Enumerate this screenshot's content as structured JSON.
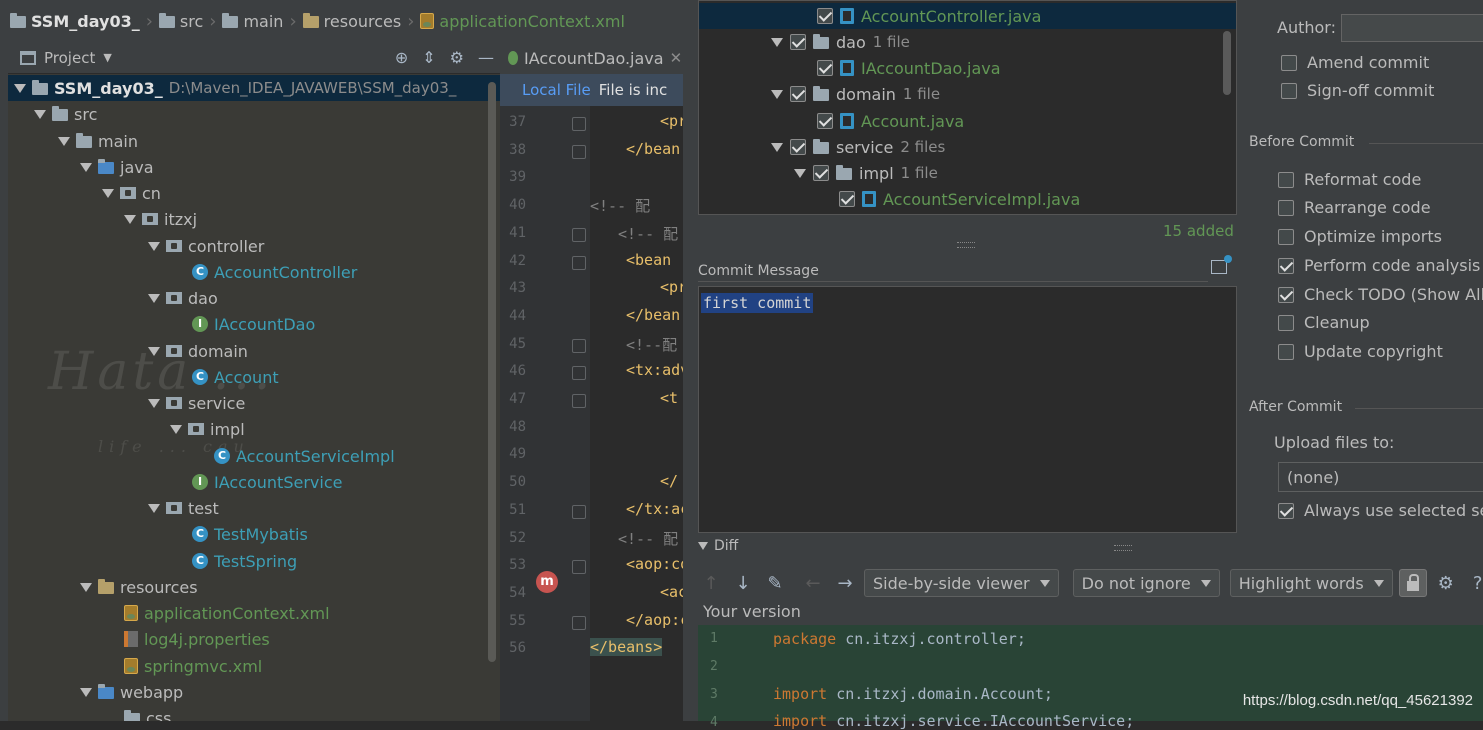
{
  "breadcrumb": {
    "items": [
      {
        "label": "SSM_day03_",
        "icon": "project-folder-icon"
      },
      {
        "label": "src",
        "icon": "folder-icon"
      },
      {
        "label": "main",
        "icon": "folder-icon"
      },
      {
        "label": "resources",
        "icon": "resources-folder-icon"
      },
      {
        "label": "applicationContext.xml",
        "icon": "xml-file-icon"
      }
    ]
  },
  "project_panel": {
    "title": "Project",
    "root": {
      "label": "SSM_day03_",
      "path": "D:\\Maven_IDEA_JAVAWEB\\SSM_day03_"
    },
    "tree": [
      {
        "label": "src",
        "kind": "folder"
      },
      {
        "label": "main",
        "kind": "folder"
      },
      {
        "label": "java",
        "kind": "source-folder"
      },
      {
        "label": "cn",
        "kind": "package"
      },
      {
        "label": "itzxj",
        "kind": "package"
      },
      {
        "label": "controller",
        "kind": "package"
      },
      {
        "label": "AccountController",
        "kind": "class"
      },
      {
        "label": "dao",
        "kind": "package"
      },
      {
        "label": "IAccountDao",
        "kind": "interface"
      },
      {
        "label": "domain",
        "kind": "package"
      },
      {
        "label": "Account",
        "kind": "class"
      },
      {
        "label": "service",
        "kind": "package"
      },
      {
        "label": "impl",
        "kind": "package"
      },
      {
        "label": "AccountServiceImpl",
        "kind": "class"
      },
      {
        "label": "IAccountService",
        "kind": "interface"
      },
      {
        "label": "test",
        "kind": "package"
      },
      {
        "label": "TestMybatis",
        "kind": "class"
      },
      {
        "label": "TestSpring",
        "kind": "class"
      },
      {
        "label": "resources",
        "kind": "resources-folder"
      },
      {
        "label": "applicationContext.xml",
        "kind": "xml"
      },
      {
        "label": "log4j.properties",
        "kind": "properties"
      },
      {
        "label": "springmvc.xml",
        "kind": "xml"
      },
      {
        "label": "webapp",
        "kind": "folder"
      },
      {
        "label": "css",
        "kind": "folder"
      }
    ]
  },
  "editor": {
    "tab_label": "IAccountDao.java",
    "local_file_label": "Local File",
    "local_file_text": "File is inc",
    "line_numbers": [
      "37",
      "38",
      "39",
      "40",
      "41",
      "42",
      "43",
      "44",
      "45",
      "46",
      "47",
      "48",
      "49",
      "50",
      "51",
      "52",
      "53",
      "54",
      "55",
      "56"
    ],
    "code_lines": [
      "<pr",
      "</bean",
      "",
      "<!--    配",
      "<!-- 配",
      "<bean",
      "<pr",
      "</bean",
      "<!--配",
      "<tx:adv",
      "<t",
      "",
      "",
      "</",
      "</tx:ac",
      "<!-- 配",
      "<aop:co",
      "<ac",
      "</aop:c",
      "</beans>"
    ]
  },
  "commit_dialog": {
    "changes": [
      {
        "label": "AccountController.java",
        "kind": "java-file",
        "checked": true
      },
      {
        "label": "dao",
        "count": "1 file",
        "kind": "folder",
        "checked": true
      },
      {
        "label": "IAccountDao.java",
        "kind": "java-file",
        "checked": true
      },
      {
        "label": "domain",
        "count": "1 file",
        "kind": "folder",
        "checked": true
      },
      {
        "label": "Account.java",
        "kind": "java-file",
        "checked": true
      },
      {
        "label": "service",
        "count": "2 files",
        "kind": "folder",
        "checked": true
      },
      {
        "label": "impl",
        "count": "1 file",
        "kind": "folder",
        "checked": true
      },
      {
        "label": "AccountServiceImpl.java",
        "kind": "java-file",
        "checked": true
      }
    ],
    "added_summary": "15 added",
    "commit_message_label": "Commit Message",
    "commit_message": "first commit",
    "author_label": "Author:",
    "author_value": "",
    "amend_commit": {
      "label": "Amend commit",
      "checked": false
    },
    "sign_off_commit": {
      "label": "Sign-off commit",
      "checked": false
    },
    "before_commit": {
      "title": "Before Commit",
      "options": [
        {
          "label": "Reformat code",
          "checked": false
        },
        {
          "label": "Rearrange code",
          "checked": false
        },
        {
          "label": "Optimize imports",
          "checked": false
        },
        {
          "label": "Perform code analysis",
          "checked": true
        },
        {
          "label": "Check TODO (Show All)",
          "checked": true,
          "link": "C"
        },
        {
          "label": "Cleanup",
          "checked": false
        },
        {
          "label": "Update copyright",
          "checked": false
        }
      ]
    },
    "after_commit": {
      "title": "After Commit",
      "upload_label": "Upload files to:",
      "upload_value": "(none)",
      "always_use": {
        "label": "Always use selected serv",
        "checked": true
      }
    },
    "diff": {
      "title": "Diff",
      "viewer": "Side-by-side viewer",
      "ignore": "Do not ignore",
      "highlight": "Highlight words",
      "your_version": "Your version",
      "line_numbers": [
        "1",
        "2",
        "3",
        "4"
      ],
      "lines": [
        "package cn.itzxj.controller;",
        "",
        "import cn.itzxj.domain.Account;",
        "import cn.itzxj.service.IAccountService;"
      ]
    }
  },
  "watermark_text": "https://blog.csdn.net/qq_45621392",
  "colors": {
    "selection": "#0d293e",
    "added_green": "#629755",
    "class_blue": "#3592c4",
    "diff_bg": "#294436"
  }
}
